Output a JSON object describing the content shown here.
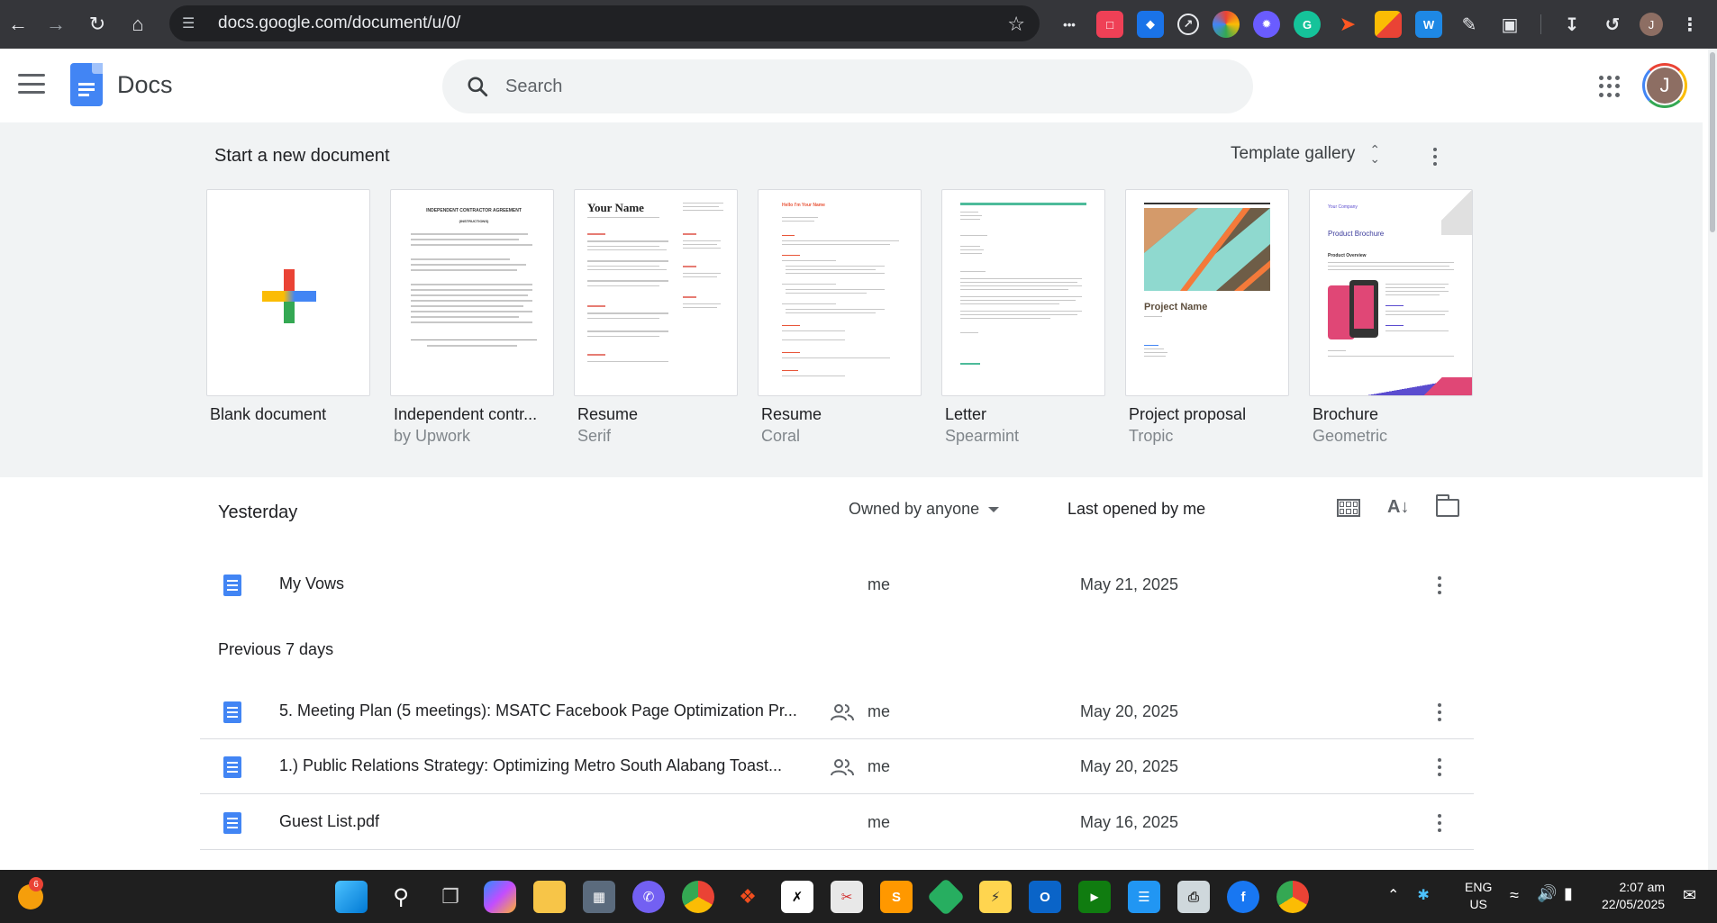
{
  "browser": {
    "url": "docs.google.com/document/u/0/",
    "profile_initial": "J"
  },
  "header": {
    "app_name": "Docs",
    "search_placeholder": "Search",
    "account_initial": "J"
  },
  "templates": {
    "title": "Start a new document",
    "gallery_label": "Template gallery",
    "items": [
      {
        "name": "Blank document",
        "sub": ""
      },
      {
        "name": "Independent contr...",
        "sub": "by Upwork"
      },
      {
        "name": "Resume",
        "sub": "Serif"
      },
      {
        "name": "Resume",
        "sub": "Coral"
      },
      {
        "name": "Letter",
        "sub": "Spearmint"
      },
      {
        "name": "Project proposal",
        "sub": "Tropic"
      },
      {
        "name": "Brochure",
        "sub": "Geometric"
      }
    ],
    "preview_text": {
      "contract_heading": "INDEPENDENT CONTRACTOR AGREEMENT",
      "contract_sub": "(INSTRUCTIONS)",
      "resume_name": "Your Name",
      "resume_coral_name": "Hello I'm Your Name",
      "proposal_title": "Project Name",
      "brochure_company": "Your Company",
      "brochure_title": "Product Brochure",
      "brochure_overview": "Product Overview"
    }
  },
  "list": {
    "section_yesterday": "Yesterday",
    "owned_filter": "Owned by anyone",
    "sort_label": "Last opened by me",
    "section_previous": "Previous 7 days",
    "rows_yesterday": [
      {
        "title": "My Vows",
        "owner": "me",
        "date": "May 21, 2025",
        "shared": false
      }
    ],
    "rows_previous": [
      {
        "title": "5. Meeting Plan (5 meetings): MSATC Facebook Page Optimization Pr...",
        "owner": "me",
        "date": "May 20, 2025",
        "shared": true
      },
      {
        "title": "1.) Public Relations Strategy: Optimizing Metro South Alabang Toast...",
        "owner": "me",
        "date": "May 20, 2025",
        "shared": true
      },
      {
        "title": "Guest List.pdf",
        "owner": "me",
        "date": "May 16, 2025",
        "shared": false
      }
    ]
  },
  "taskbar": {
    "weather_badge": "6",
    "lang_top": "ENG",
    "lang_bottom": "US",
    "time": "2:07 am",
    "date": "22/05/2025"
  }
}
